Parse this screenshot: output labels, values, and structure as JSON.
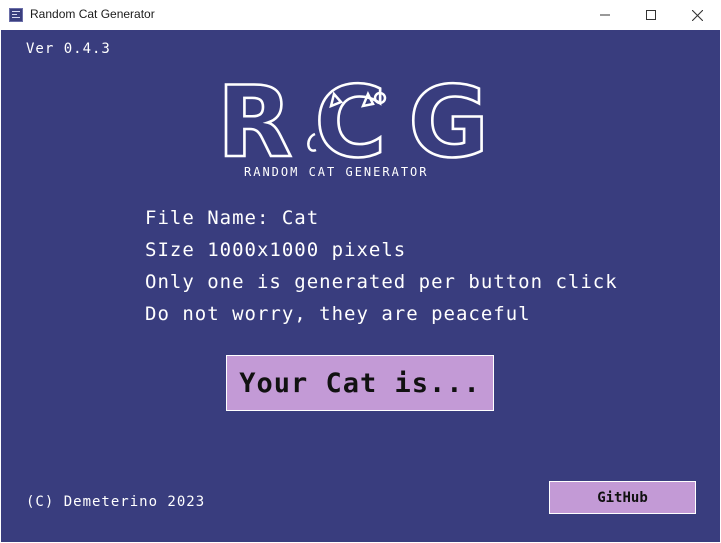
{
  "window": {
    "title": "Random Cat Generator",
    "icons": {
      "app": "app-icon",
      "minimize": "minimize-icon",
      "maximize": "maximize-icon",
      "close": "close-icon"
    }
  },
  "app": {
    "version": "Ver 0.4.3",
    "logo_text": "RCG",
    "subtitle": "RANDOM CAT GENERATOR",
    "info_lines": [
      "File Name: Cat",
      "SIze 1000x1000 pixels",
      "Only one is generated per button click",
      "Do not worry, they are peaceful"
    ],
    "generate_button": "Your Cat is...",
    "footer": "(C) Demeterino 2023",
    "github_button": "GitHub"
  },
  "colors": {
    "background": "#393d7e",
    "button": "#c39ad6",
    "text": "#ffffff"
  }
}
